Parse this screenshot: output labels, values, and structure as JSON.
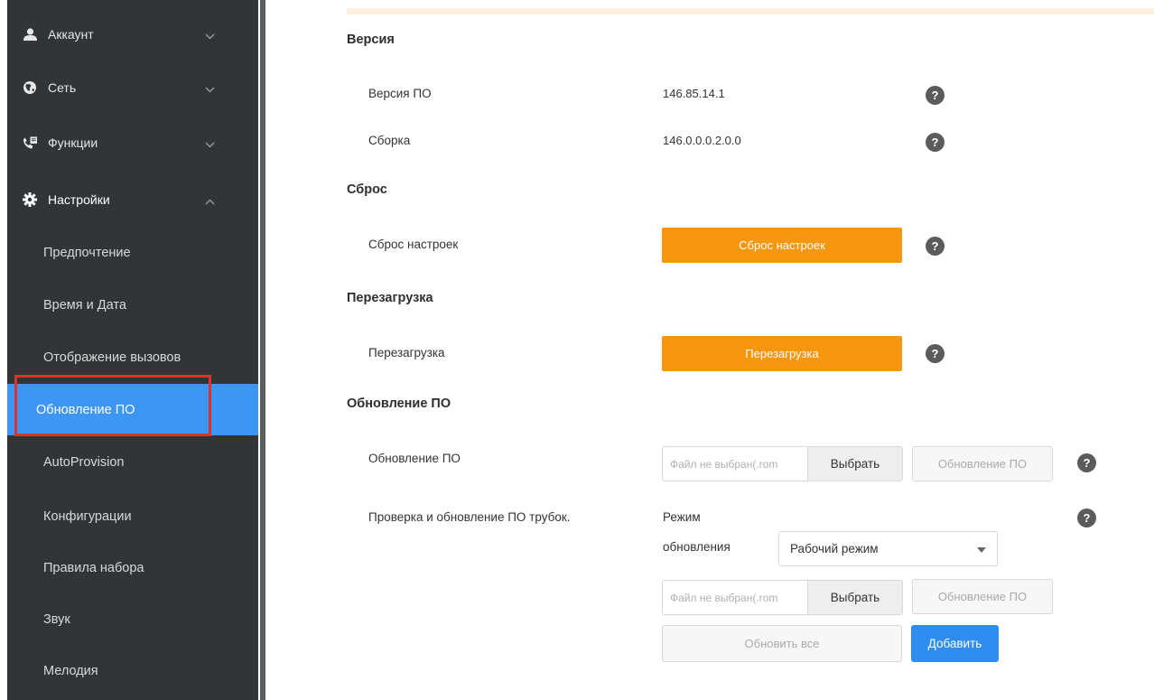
{
  "sidebar": {
    "groups": [
      {
        "label": "Аккаунт",
        "icon": "user-icon",
        "expanded": false
      },
      {
        "label": "Сеть",
        "icon": "globe-icon",
        "expanded": false
      },
      {
        "label": "Функции",
        "icon": "phone-book-icon",
        "expanded": false
      },
      {
        "label": "Настройки",
        "icon": "gear-icon",
        "expanded": true
      }
    ],
    "items": [
      {
        "label": "Предпочтение"
      },
      {
        "label": "Время и Дата"
      },
      {
        "label": "Отображение вызовов"
      },
      {
        "label": "Обновление ПО",
        "active": true
      },
      {
        "label": "AutoProvision"
      },
      {
        "label": "Конфигурации"
      },
      {
        "label": "Правила набора"
      },
      {
        "label": "Звук"
      },
      {
        "label": "Мелодия"
      }
    ]
  },
  "version": {
    "title": "Версия",
    "firmware_label": "Версия ПО",
    "firmware_value": "146.85.14.1",
    "build_label": "Сборка",
    "build_value": "146.0.0.0.2.0.0"
  },
  "reset": {
    "title": "Сброс",
    "label": "Сброс настроек",
    "button": "Сброс настроек"
  },
  "reboot": {
    "title": "Перезагрузка",
    "label": "Перезагрузка",
    "button": "Перезагрузка"
  },
  "upgrade": {
    "title": "Обновление ПО",
    "label": "Обновление ПО",
    "file_placeholder": "Файл не выбран(.rom",
    "choose_button": "Выбрать",
    "upgrade_button": "Обновление ПО"
  },
  "handset": {
    "label": "Проверка и обновление ПО трубок.",
    "mode_label_line1": "Режим",
    "mode_label_line2": "обновления",
    "mode_value": "Рабочий режим",
    "file_placeholder": "Файл не выбран(.rom",
    "choose_button": "Выбрать",
    "upgrade_button": "Обновление ПО",
    "update_all_button": "Обновить все",
    "add_button": "Добавить"
  },
  "help_symbol": "?",
  "colors": {
    "sidebar_bg": "#323537",
    "active_item": "#3d96f4",
    "highlight_box": "#e0302a",
    "orange_button": "#f7960f",
    "blue_button": "#2f8cf0"
  }
}
